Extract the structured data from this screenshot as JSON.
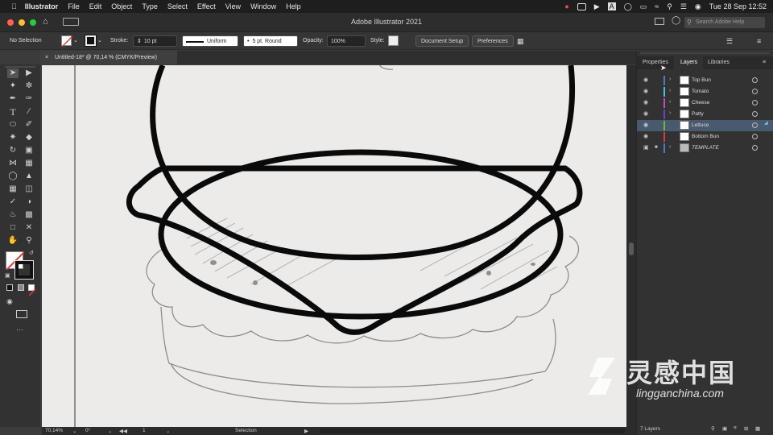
{
  "menubar": {
    "app": "Illustrator",
    "items": [
      "File",
      "Edit",
      "Object",
      "Type",
      "Select",
      "Effect",
      "View",
      "Window",
      "Help"
    ],
    "clock": "Tue 28 Sep  12:52"
  },
  "titlebar": {
    "title": "Adobe Illustrator 2021",
    "search_placeholder": "Search Adobe Help"
  },
  "controlbar": {
    "selection": "No Selection",
    "stroke_label": "Stroke:",
    "stroke_value": "10 pt",
    "profile": "Uniform",
    "brush": "5 pt. Round",
    "opacity_label": "Opacity:",
    "opacity_value": "100%",
    "style_label": "Style:",
    "document_setup": "Document Setup",
    "preferences": "Preferences"
  },
  "document": {
    "tab_label": "Untitled-18* @ 70,14 % (CMYK/Preview)"
  },
  "statusbar": {
    "zoom": "70,14%",
    "rotation": "0°",
    "artboard": "1",
    "tool": "Selection"
  },
  "panel": {
    "tabs": [
      "Properties",
      "Layers",
      "Libraries"
    ],
    "active_tab": "Layers",
    "layers": [
      {
        "name": "Top Bun",
        "color": "#4a7ccf",
        "expandable": true,
        "selected": false,
        "locked": false
      },
      {
        "name": "Tomato",
        "color": "#3fc7d6",
        "expandable": true,
        "selected": false,
        "locked": false
      },
      {
        "name": "Cheese",
        "color": "#c847c2",
        "expandable": true,
        "selected": false,
        "locked": false
      },
      {
        "name": "Patty",
        "color": "#6b3fd0",
        "expandable": true,
        "selected": false,
        "locked": false
      },
      {
        "name": "Lettuce",
        "color": "#56c24a",
        "expandable": false,
        "selected": true,
        "locked": false
      },
      {
        "name": "Bottom Bun",
        "color": "#e03a3a",
        "expandable": false,
        "selected": false,
        "locked": false
      },
      {
        "name": "TEMPLATE",
        "color": "#4a7ccf",
        "expandable": true,
        "selected": false,
        "locked": true
      }
    ],
    "footer_count": "7 Layers"
  },
  "watermark": {
    "brand": "灵感中国",
    "url": "lingganchina.com"
  },
  "colors": {
    "selected_row": "#4a5a6e",
    "canvas": "#ecebe9"
  }
}
